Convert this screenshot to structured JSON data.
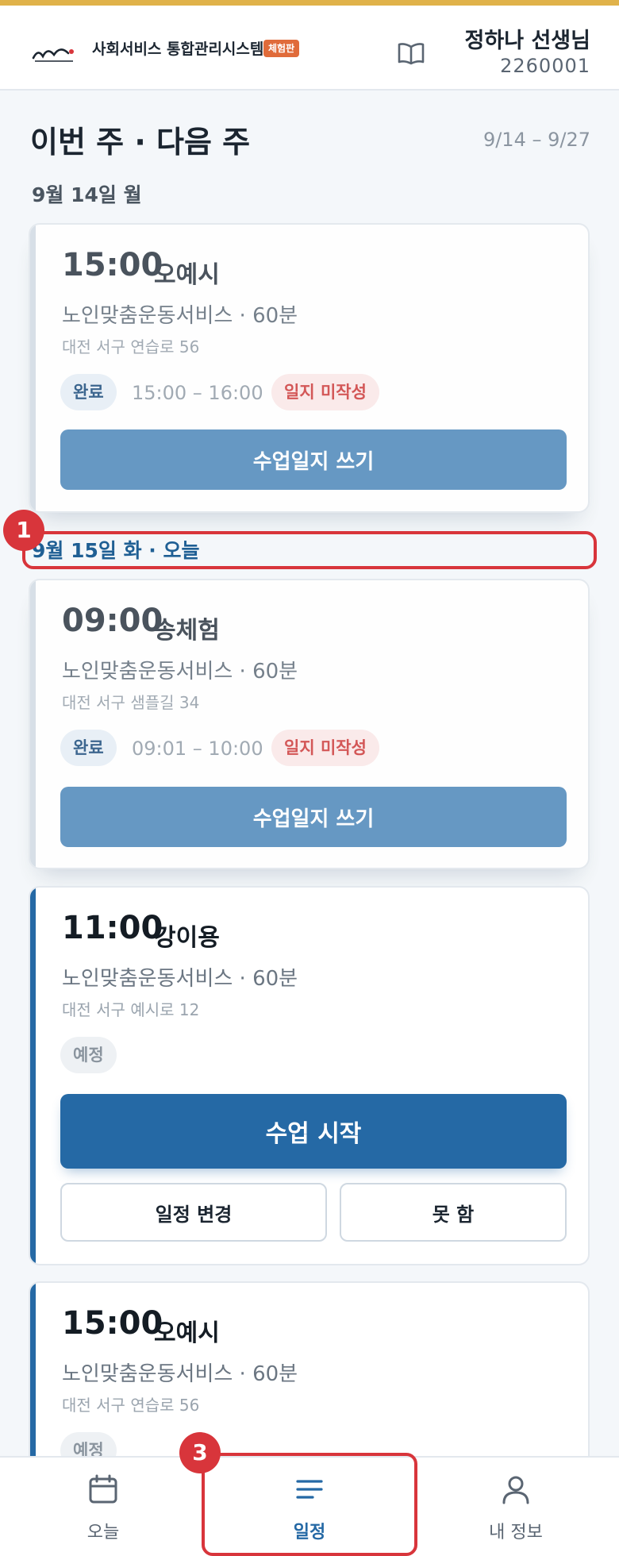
{
  "header": {
    "app_title": "사회서비스 통합관리시스템",
    "trial_badge": "체험판",
    "user_name": "정하나 선생님",
    "user_id": "2260001"
  },
  "page": {
    "title": "이번 주 · 다음 주",
    "date_range": "9/14 – 9/27"
  },
  "days": [
    {
      "label": "9월 14일 월"
    },
    {
      "label": "9월 15일 화 · 오늘"
    }
  ],
  "sessions": [
    {
      "time": "15:00",
      "name": "오예시",
      "service": "노인맞춤운동서비스 · 60분",
      "address": "대전 서구 연습로 56",
      "status": "완료",
      "actual_time": "15:00 – 16:00",
      "log_status": "일지 미작성",
      "action": "수업일지 쓰기"
    },
    {
      "time": "09:00",
      "name": "송체험",
      "service": "노인맞춤운동서비스 · 60분",
      "address": "대전 서구 샘플길 34",
      "status": "완료",
      "actual_time": "09:01 – 10:00",
      "log_status": "일지 미작성",
      "action": "수업일지 쓰기"
    },
    {
      "time": "11:00",
      "name": "강이용",
      "service": "노인맞춤운동서비스 · 60분",
      "address": "대전 서구 예시로 12",
      "status": "예정",
      "action": "수업 시작",
      "reschedule": "일정 변경",
      "cancel": "못 함"
    },
    {
      "time": "15:00",
      "name": "오예시",
      "service": "노인맞춤운동서비스 · 60분",
      "address": "대전 서구 연습로 56",
      "status": "예정"
    }
  ],
  "annotations": [
    {
      "number": "1"
    },
    {
      "number": "3"
    }
  ],
  "nav": {
    "today": "오늘",
    "schedule": "일정",
    "profile": "내 정보"
  },
  "colors": {
    "accent_bar": "#e0b24a",
    "primary": "#2569a5",
    "primary_light": "#5a90bf",
    "warning": "#d14a4a",
    "annotation": "#d8353b"
  }
}
